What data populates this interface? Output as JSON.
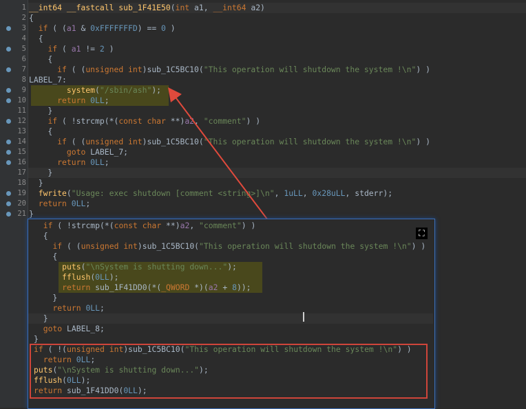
{
  "editor_lines": [
    {
      "n": "1",
      "bp": false,
      "hl": "current",
      "parts": [
        [
          "fn",
          "__int64 __fastcall sub_1F41E50"
        ],
        [
          "plain",
          "("
        ],
        [
          "kw",
          "int"
        ],
        [
          "plain",
          " a1, "
        ],
        [
          "kw",
          "__int64"
        ],
        [
          "plain",
          " a2)"
        ]
      ]
    },
    {
      "n": "2",
      "bp": false,
      "parts": [
        [
          "plain",
          "{"
        ]
      ]
    },
    {
      "n": "3",
      "bp": true,
      "parts": [
        [
          "plain",
          "  "
        ],
        [
          "kw",
          "if"
        ],
        [
          "plain",
          " ( ("
        ],
        [
          "var",
          "a1"
        ],
        [
          "plain",
          " & "
        ],
        [
          "num",
          "0xFFFFFFFD"
        ],
        [
          "plain",
          ") == "
        ],
        [
          "num",
          "0"
        ],
        [
          "plain",
          " )"
        ]
      ]
    },
    {
      "n": "4",
      "bp": false,
      "parts": [
        [
          "plain",
          "  {"
        ]
      ]
    },
    {
      "n": "5",
      "bp": true,
      "parts": [
        [
          "plain",
          "    "
        ],
        [
          "kw",
          "if"
        ],
        [
          "plain",
          " ( "
        ],
        [
          "var",
          "a1"
        ],
        [
          "plain",
          " != "
        ],
        [
          "num",
          "2"
        ],
        [
          "plain",
          " )"
        ]
      ]
    },
    {
      "n": "6",
      "bp": false,
      "parts": [
        [
          "plain",
          "    {"
        ]
      ]
    },
    {
      "n": "7",
      "bp": true,
      "parts": [
        [
          "plain",
          "      "
        ],
        [
          "kw",
          "if"
        ],
        [
          "plain",
          " ( ("
        ],
        [
          "kw",
          "unsigned int"
        ],
        [
          "plain",
          ")sub_1C5BC10("
        ],
        [
          "str",
          "\"This operation will shutdown the system !\\n\""
        ],
        [
          "plain",
          ") )"
        ]
      ]
    },
    {
      "n": "8",
      "bp": false,
      "parts": [
        [
          "plain",
          "LABEL_7:"
        ]
      ]
    },
    {
      "n": "9",
      "bp": true,
      "hl": "yellow",
      "parts": [
        [
          "plain",
          "        "
        ],
        [
          "fn",
          "system"
        ],
        [
          "plain",
          "("
        ],
        [
          "str",
          "\"/sbin/ash\""
        ],
        [
          "plain",
          ");"
        ]
      ]
    },
    {
      "n": "10",
      "bp": true,
      "hl": "yellow",
      "parts": [
        [
          "plain",
          "      "
        ],
        [
          "kw",
          "return"
        ],
        [
          "plain",
          " "
        ],
        [
          "num",
          "0LL"
        ],
        [
          "plain",
          ";"
        ]
      ]
    },
    {
      "n": "11",
      "bp": false,
      "parts": [
        [
          "plain",
          "    }"
        ]
      ]
    },
    {
      "n": "12",
      "bp": true,
      "parts": [
        [
          "plain",
          "    "
        ],
        [
          "kw",
          "if"
        ],
        [
          "plain",
          " ( !strcmp(*("
        ],
        [
          "kw",
          "const char"
        ],
        [
          "plain",
          " **)"
        ],
        [
          "var",
          "a2"
        ],
        [
          "plain",
          ", "
        ],
        [
          "str",
          "\"comment\""
        ],
        [
          "plain",
          ") )"
        ]
      ]
    },
    {
      "n": "13",
      "bp": false,
      "parts": [
        [
          "plain",
          "    {"
        ]
      ]
    },
    {
      "n": "14",
      "bp": true,
      "parts": [
        [
          "plain",
          "      "
        ],
        [
          "kw",
          "if"
        ],
        [
          "plain",
          " ( ("
        ],
        [
          "kw",
          "unsigned int"
        ],
        [
          "plain",
          ")sub_1C5BC10("
        ],
        [
          "str",
          "\"This operation will shutdown the system !\\n\""
        ],
        [
          "plain",
          ") )"
        ]
      ]
    },
    {
      "n": "15",
      "bp": true,
      "parts": [
        [
          "plain",
          "        "
        ],
        [
          "kw",
          "goto"
        ],
        [
          "plain",
          " LABEL_7;"
        ]
      ]
    },
    {
      "n": "16",
      "bp": true,
      "parts": [
        [
          "plain",
          "      "
        ],
        [
          "kw",
          "return"
        ],
        [
          "plain",
          " "
        ],
        [
          "num",
          "0LL"
        ],
        [
          "plain",
          ";"
        ]
      ]
    },
    {
      "n": "17",
      "bp": false,
      "hl": "current",
      "parts": [
        [
          "plain",
          "    }"
        ]
      ]
    },
    {
      "n": "18",
      "bp": false,
      "parts": [
        [
          "plain",
          "  }"
        ]
      ]
    },
    {
      "n": "19",
      "bp": true,
      "parts": [
        [
          "plain",
          "  "
        ],
        [
          "fn",
          "fwrite"
        ],
        [
          "plain",
          "("
        ],
        [
          "str",
          "\"Usage: exec shutdown [comment <string>]\\n\""
        ],
        [
          "plain",
          ", "
        ],
        [
          "num",
          "1uLL"
        ],
        [
          "plain",
          ", "
        ],
        [
          "num",
          "0x28uLL"
        ],
        [
          "plain",
          ", stderr);"
        ]
      ]
    },
    {
      "n": "20",
      "bp": true,
      "parts": [
        [
          "plain",
          "  "
        ],
        [
          "kw",
          "return"
        ],
        [
          "plain",
          " "
        ],
        [
          "num",
          "0LL"
        ],
        [
          "plain",
          ";"
        ]
      ]
    },
    {
      "n": "21",
      "bp": true,
      "parts": [
        [
          "plain",
          "}"
        ]
      ]
    }
  ],
  "popup_lines": [
    {
      "parts": [
        [
          "plain",
          "  "
        ],
        [
          "kw",
          "if"
        ],
        [
          "plain",
          " ( !strcmp(*("
        ],
        [
          "kw",
          "const char"
        ],
        [
          "plain",
          " **)"
        ],
        [
          "var",
          "a2"
        ],
        [
          "plain",
          ", "
        ],
        [
          "str",
          "\"comment\""
        ],
        [
          "plain",
          ") )"
        ]
      ]
    },
    {
      "parts": [
        [
          "plain",
          "  {"
        ]
      ]
    },
    {
      "parts": [
        [
          "plain",
          "    "
        ],
        [
          "kw",
          "if"
        ],
        [
          "plain",
          " ( ("
        ],
        [
          "kw",
          "unsigned int"
        ],
        [
          "plain",
          ")sub_1C5BC10("
        ],
        [
          "str",
          "\"This operation will shutdown the system !\\n\""
        ],
        [
          "plain",
          ") )"
        ]
      ]
    },
    {
      "parts": [
        [
          "plain",
          "    {"
        ]
      ]
    },
    {
      "hl": "yellow",
      "parts": [
        [
          "plain",
          "      "
        ],
        [
          "fn",
          "puts"
        ],
        [
          "plain",
          "("
        ],
        [
          "str",
          "\"\\nSystem is shutting down...\""
        ],
        [
          "plain",
          ");"
        ]
      ]
    },
    {
      "hl": "yellow",
      "parts": [
        [
          "plain",
          "      "
        ],
        [
          "fn",
          "fflush"
        ],
        [
          "plain",
          "("
        ],
        [
          "num",
          "0LL"
        ],
        [
          "plain",
          ");"
        ]
      ]
    },
    {
      "hl": "yellow",
      "parts": [
        [
          "plain",
          "      "
        ],
        [
          "kw",
          "return"
        ],
        [
          "plain",
          " sub_1F41DD0(*("
        ],
        [
          "kw",
          "_QWORD"
        ],
        [
          "plain",
          " *)("
        ],
        [
          "var",
          "a2"
        ],
        [
          "plain",
          " + "
        ],
        [
          "num",
          "8"
        ],
        [
          "plain",
          "));"
        ]
      ]
    },
    {
      "parts": [
        [
          "plain",
          "    }"
        ]
      ]
    },
    {
      "parts": [
        [
          "plain",
          "    "
        ],
        [
          "kw",
          "return"
        ],
        [
          "plain",
          " "
        ],
        [
          "num",
          "0LL"
        ],
        [
          "plain",
          ";"
        ]
      ]
    },
    {
      "hl": "current",
      "parts": [
        [
          "plain",
          "  }"
        ]
      ]
    },
    {
      "parts": [
        [
          "plain",
          "  "
        ],
        [
          "kw",
          "goto"
        ],
        [
          "plain",
          " LABEL_8;"
        ]
      ]
    },
    {
      "parts": [
        [
          "plain",
          "}"
        ]
      ]
    },
    {
      "parts": [
        [
          "kw",
          "if"
        ],
        [
          "plain",
          " ( !("
        ],
        [
          "kw",
          "unsigned int"
        ],
        [
          "plain",
          ")sub_1C5BC10("
        ],
        [
          "str",
          "\"This operation will shutdown the system !\\n\""
        ],
        [
          "plain",
          ") )"
        ]
      ]
    },
    {
      "parts": [
        [
          "plain",
          "  "
        ],
        [
          "kw",
          "return"
        ],
        [
          "plain",
          " "
        ],
        [
          "num",
          "0LL"
        ],
        [
          "plain",
          ";"
        ]
      ]
    },
    {
      "parts": [
        [
          "fn",
          "puts"
        ],
        [
          "plain",
          "("
        ],
        [
          "str",
          "\"\\nSystem is shutting down...\""
        ],
        [
          "plain",
          ");"
        ]
      ]
    },
    {
      "parts": [
        [
          "fn",
          "fflush"
        ],
        [
          "plain",
          "("
        ],
        [
          "num",
          "0LL"
        ],
        [
          "plain",
          ");"
        ]
      ]
    },
    {
      "parts": [
        [
          "kw",
          "return"
        ],
        [
          "plain",
          " sub_1F41DD0("
        ],
        [
          "num",
          "0LL"
        ],
        [
          "plain",
          ");"
        ]
      ]
    }
  ],
  "colors": {
    "keyword": "#cc7832",
    "string": "#6a8759",
    "function": "#ffc66d",
    "number": "#6897bb",
    "variable": "#9876aa",
    "arrow": "#e04a3c",
    "annotation_box": "#d0453a"
  },
  "icons": {
    "expand": "expand-icon",
    "breakpoint": "breakpoint-dot-icon"
  }
}
